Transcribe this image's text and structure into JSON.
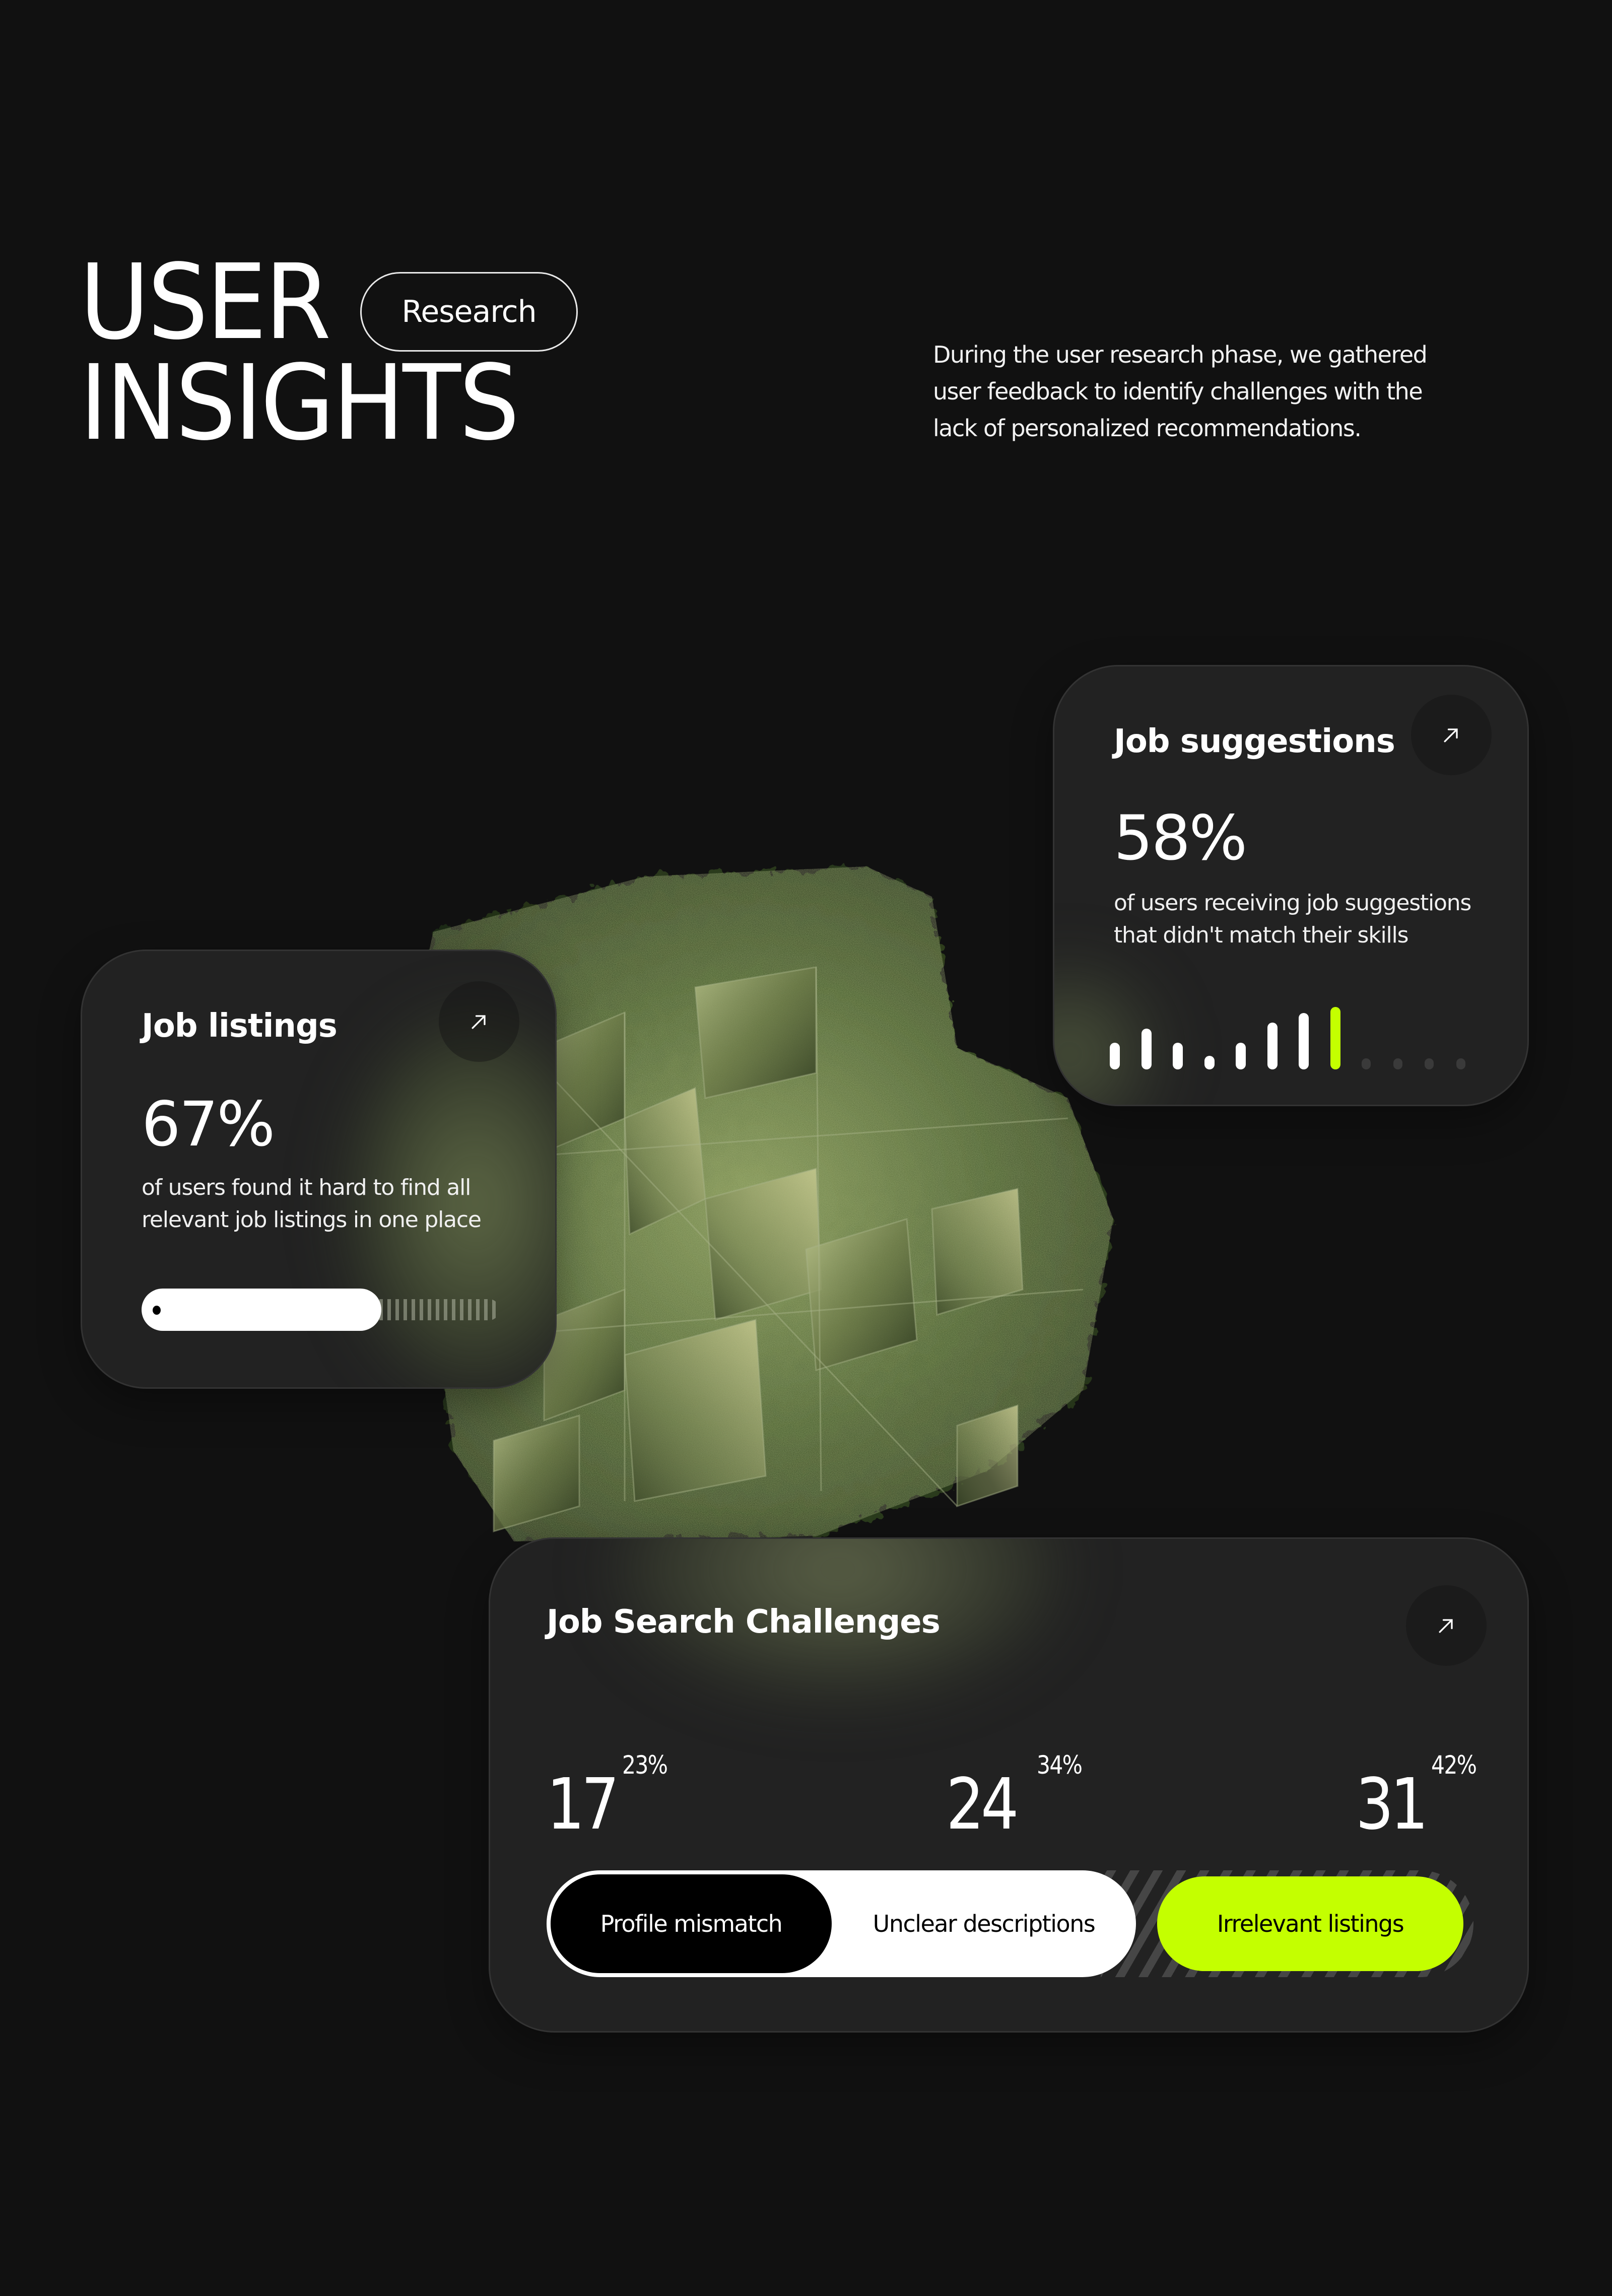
{
  "header": {
    "title_line1": "USER",
    "title_line2": "INSIGHTS",
    "tag": "Research",
    "description": "During the user research phase, we gathered user feedback to identify challenges with the lack of personalized recommendations."
  },
  "theme": {
    "background": "#111111",
    "card": "#222222",
    "accent": "#c4ff00",
    "text": "#ffffff"
  },
  "decoration": {
    "icon": "foliage-glass-cube-illustration"
  },
  "cards": {
    "suggestions": {
      "title": "Job suggestions",
      "stat": "58%",
      "description": "of users receiving job suggestions that didn't match their skills",
      "arrow_icon": "arrow-up-right-icon",
      "bars": [
        {
          "level": 0.43,
          "state": "active"
        },
        {
          "level": 0.65,
          "state": "active"
        },
        {
          "level": 0.43,
          "state": "active"
        },
        {
          "level": 0.22,
          "state": "active"
        },
        {
          "level": 0.43,
          "state": "active"
        },
        {
          "level": 0.75,
          "state": "active"
        },
        {
          "level": 0.9,
          "state": "active"
        },
        {
          "level": 1.0,
          "state": "accent"
        },
        {
          "level": 0.2,
          "state": "inactive"
        },
        {
          "level": 0.2,
          "state": "inactive"
        },
        {
          "level": 0.2,
          "state": "inactive"
        },
        {
          "level": 0.2,
          "state": "inactive"
        }
      ]
    },
    "listings": {
      "title": "Job listings",
      "stat": "67%",
      "description": "of users found it hard to find all relevant job listings in one place",
      "arrow_icon": "arrow-up-right-icon",
      "progress": 0.67
    },
    "challenges": {
      "title": "Job Search Challenges",
      "arrow_icon": "arrow-up-right-icon",
      "items": [
        {
          "count": "17",
          "percent": "23%",
          "label": "Profile mismatch"
        },
        {
          "count": "24",
          "percent": "34%",
          "label": "Unclear descriptions"
        },
        {
          "count": "31",
          "percent": "42%",
          "label": "Irrelevant listings"
        }
      ]
    }
  }
}
